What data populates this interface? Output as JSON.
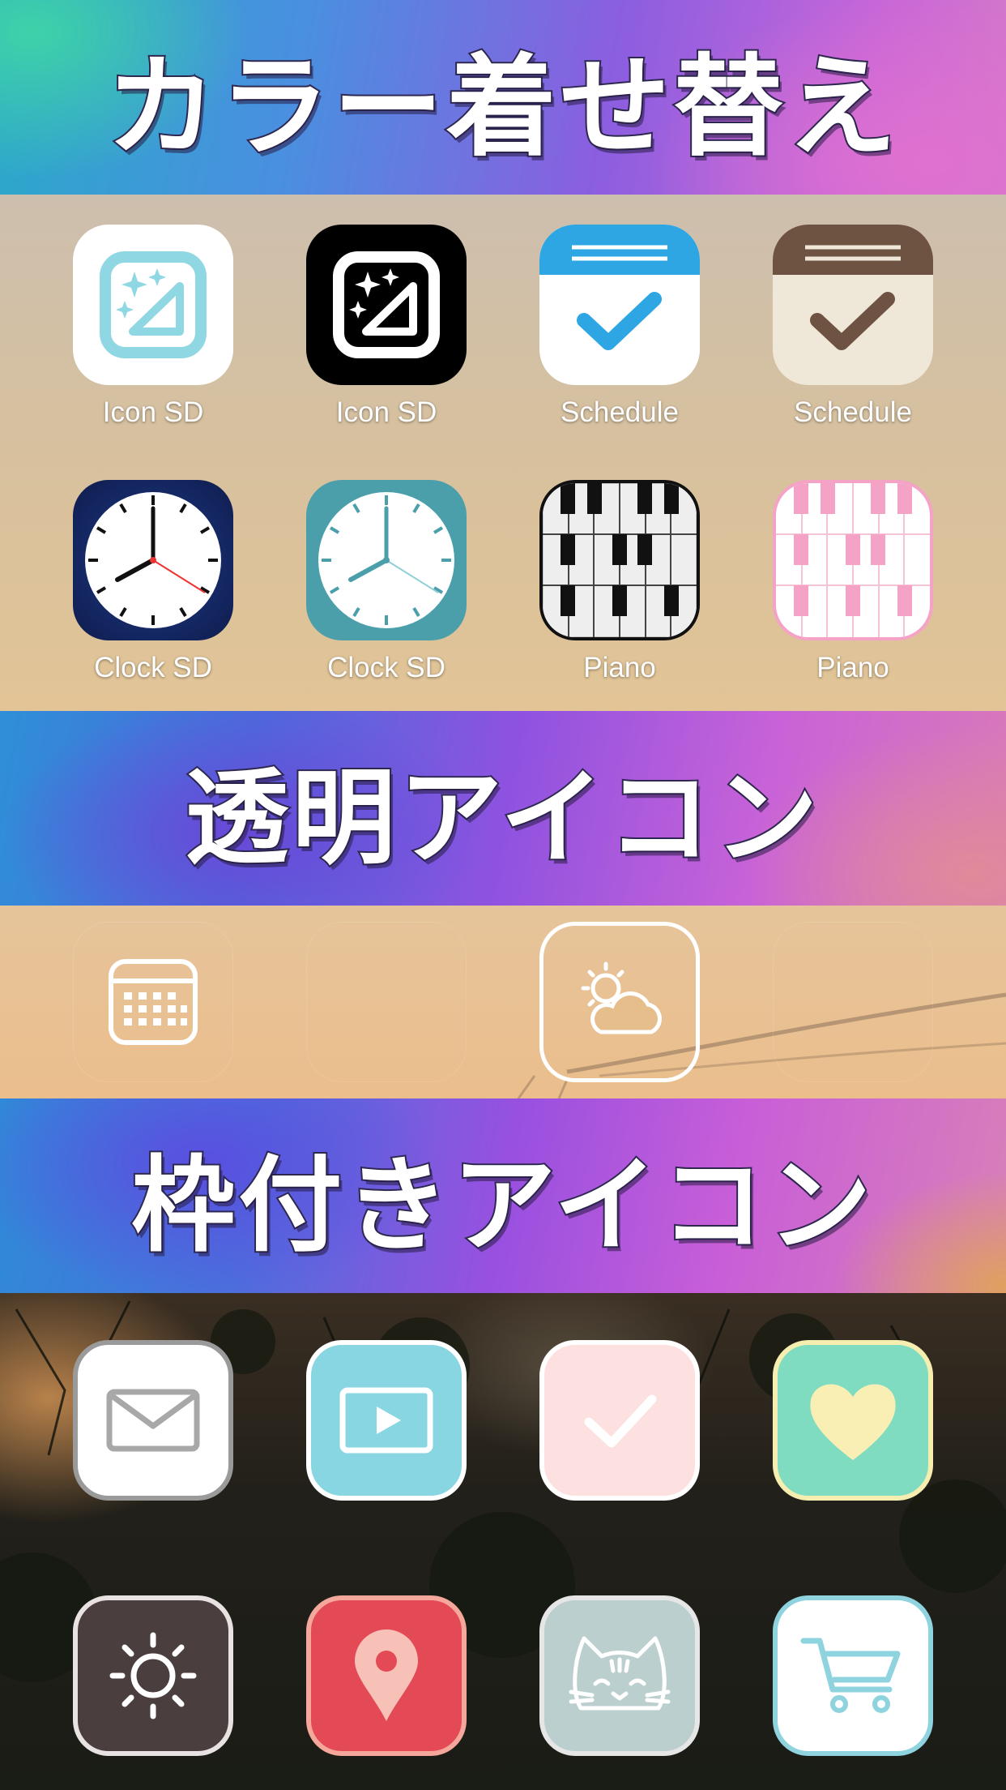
{
  "banners": {
    "color_theme": "カラー着せ替え",
    "transparent_icons": "透明アイコン",
    "framed_icons": "枠付きアイコン"
  },
  "color_theme_icons": [
    {
      "label": "Icon SD",
      "icon": "icon-sd-light-icon",
      "color": "#ffffff"
    },
    {
      "label": "Icon SD",
      "icon": "icon-sd-dark-icon",
      "color": "#000000"
    },
    {
      "label": "Schedule",
      "icon": "schedule-blue-icon",
      "color": "#2ea6e4"
    },
    {
      "label": "Schedule",
      "icon": "schedule-brown-icon",
      "color": "#6e5343"
    },
    {
      "label": "Clock SD",
      "icon": "clock-navy-icon",
      "color": "#14275e"
    },
    {
      "label": "Clock SD",
      "icon": "clock-teal-icon",
      "color": "#4a9fab"
    },
    {
      "label": "Piano",
      "icon": "piano-black-icon",
      "color": "#111111"
    },
    {
      "label": "Piano",
      "icon": "piano-pink-icon",
      "color": "#f4a3c7"
    }
  ],
  "transparent_icons": [
    {
      "icon": "calendar-icon"
    },
    {
      "icon": "blank-icon"
    },
    {
      "icon": "weather-icon"
    },
    {
      "icon": "blank-icon"
    }
  ],
  "framed_icons": [
    {
      "icon": "mail-icon",
      "color": "#ffffff"
    },
    {
      "icon": "video-icon",
      "color": "#88d6e2"
    },
    {
      "icon": "check-icon",
      "color": "#fde0e0"
    },
    {
      "icon": "heart-icon",
      "color": "#7fdcc0"
    },
    {
      "icon": "settings-sun-icon",
      "color": "#4a3e3e"
    },
    {
      "icon": "map-pin-icon",
      "color": "#e34a55"
    },
    {
      "icon": "cat-icon",
      "color": "#bccfcf"
    },
    {
      "icon": "cart-icon",
      "color": "#ffffff"
    }
  ]
}
